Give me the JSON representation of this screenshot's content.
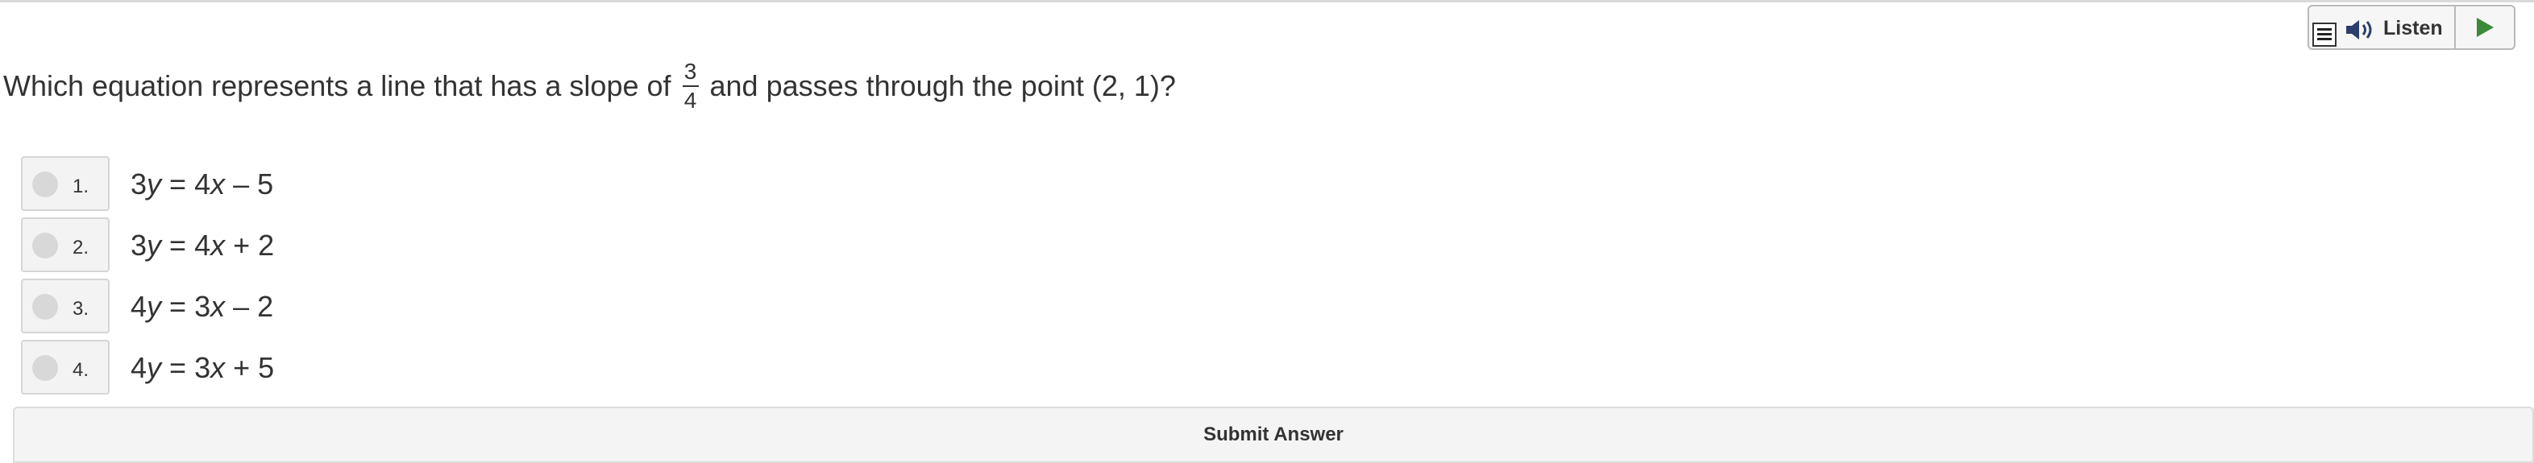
{
  "listen_widget": {
    "label": "Listen",
    "icons": [
      "menu-icon",
      "speaker-icon",
      "play-icon"
    ],
    "play_color": "#3a8a3a"
  },
  "question": {
    "text_before": "Which equation represents a line that has a slope of",
    "slope_numerator": "3",
    "slope_denominator": "4",
    "text_after": "and passes through the point (2, 1)?"
  },
  "options": [
    {
      "number": "1.",
      "lhs_coef": "3",
      "lhs_var": "y",
      "eq": " = ",
      "rhs_coef": "4",
      "rhs_var": "x",
      "rhs_rest": " – 5"
    },
    {
      "number": "2.",
      "lhs_coef": "3",
      "lhs_var": "y",
      "eq": " = ",
      "rhs_coef": "4",
      "rhs_var": "x",
      "rhs_rest": " + 2"
    },
    {
      "number": "3.",
      "lhs_coef": "4",
      "lhs_var": "y",
      "eq": " = ",
      "rhs_coef": "3",
      "rhs_var": "x",
      "rhs_rest": " – 2"
    },
    {
      "number": "4.",
      "lhs_coef": "4",
      "lhs_var": "y",
      "eq": " = ",
      "rhs_coef": "3",
      "rhs_var": "x",
      "rhs_rest": " + 5"
    }
  ],
  "submit": {
    "label": "Submit Answer"
  }
}
